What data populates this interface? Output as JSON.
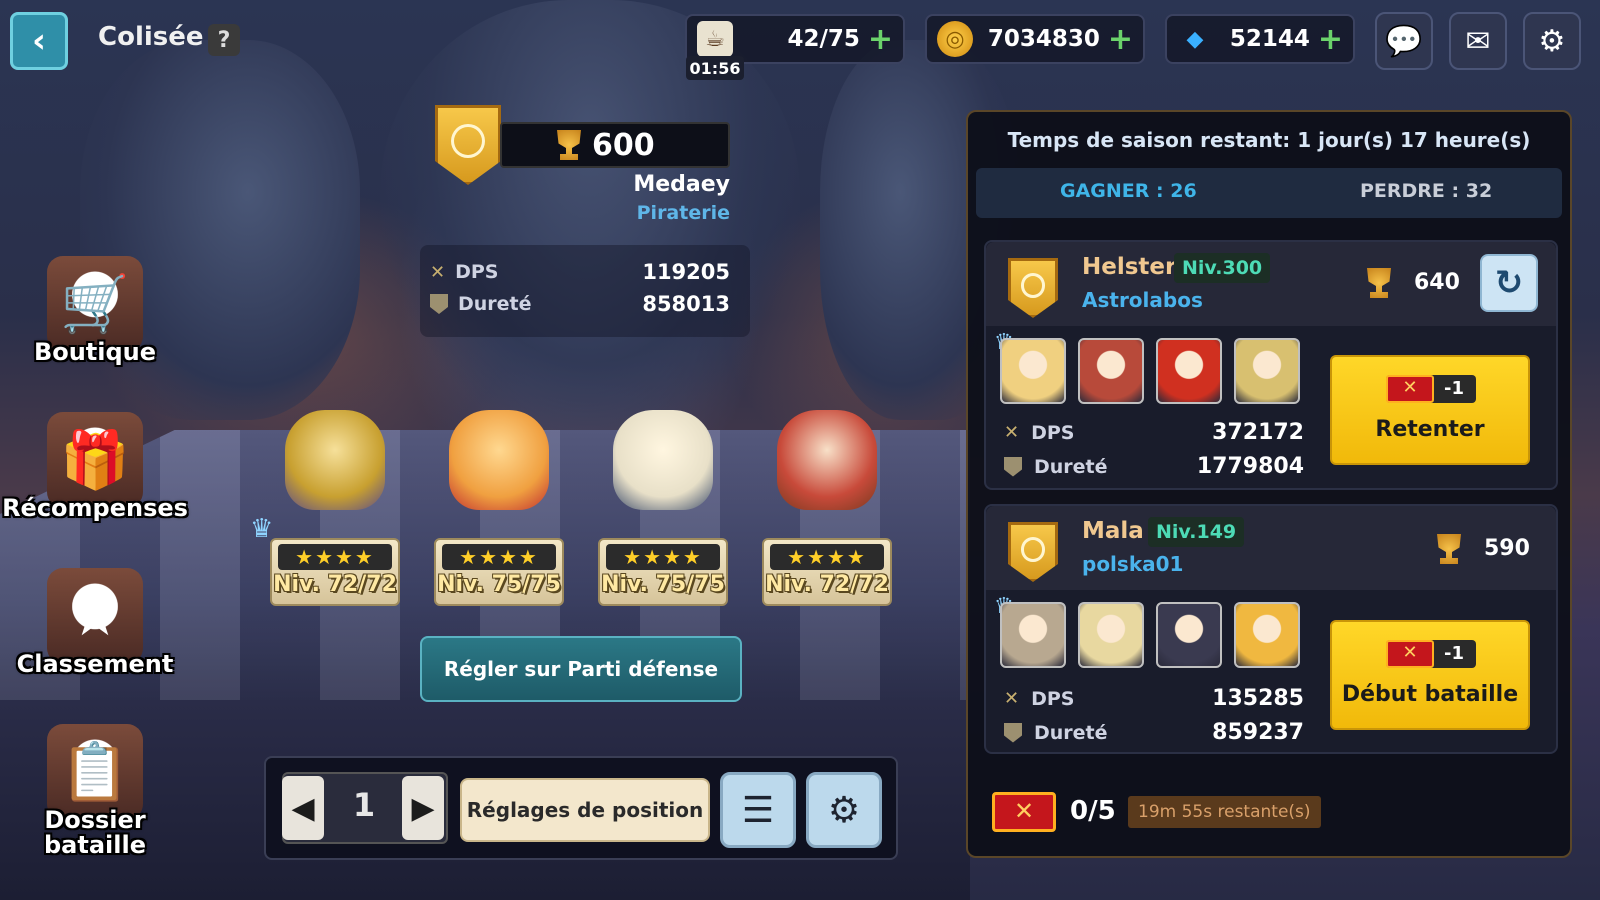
{
  "header": {
    "title": "Colisée",
    "help_label": "?",
    "stamina": "42/75",
    "stamina_timer": "01:56",
    "gold": "7034830",
    "gems": "52144",
    "plus": "+"
  },
  "player": {
    "score": "600",
    "name": "Medaey",
    "guild": "Piraterie",
    "dps_label": "DPS",
    "dps": "119205",
    "toughness_label": "Dureté",
    "toughness": "858013"
  },
  "side_menu": [
    {
      "label": "Boutique",
      "icon": "cart-icon"
    },
    {
      "label": "Récompenses",
      "icon": "gift-icon"
    },
    {
      "label": "Classement",
      "icon": "podium-icon"
    },
    {
      "label": "Dossier bataille",
      "icon": "battle-folder-icon"
    }
  ],
  "heroes": [
    {
      "stars": "★★★★",
      "level": "Niv. 72/72",
      "color": "#e8c24a"
    },
    {
      "stars": "★★★★",
      "level": "Niv. 75/75",
      "color": "#f0a040"
    },
    {
      "stars": "★★★★",
      "level": "Niv. 75/75",
      "color": "#e8e0c8"
    },
    {
      "stars": "★★★★",
      "level": "Niv. 72/72",
      "color": "#c84a3a"
    }
  ],
  "defense_button": "Régler sur Parti défense",
  "bottom_bar": {
    "page": "1",
    "position_settings": "Réglages de position"
  },
  "panel": {
    "season": "Temps de saison restant: 1 jour(s) 17 heure(s)",
    "win_label": "GAGNER : 26",
    "lose_label": "PERDRE : 32",
    "opponents": [
      {
        "name": "Helster",
        "level": "Niv.300",
        "guild": "Astrolabos",
        "score": "640",
        "dps": "372172",
        "toughness": "1779804",
        "button": "Retenter",
        "cost": "-1",
        "portraits": [
          "#f0d080",
          "#b84a3a",
          "#d03020",
          "#d8c070"
        ]
      },
      {
        "name": "Mala",
        "level": "Niv.149",
        "guild": "polska01",
        "score": "590",
        "dps": "135285",
        "toughness": "859237",
        "button": "Début bataille",
        "cost": "-1",
        "portraits": [
          "#b8a890",
          "#e8d8a0",
          "#3a3a50",
          "#f0b840"
        ]
      }
    ],
    "tickets": "0/5",
    "ticket_timer": "19m 55s restante(s)"
  }
}
